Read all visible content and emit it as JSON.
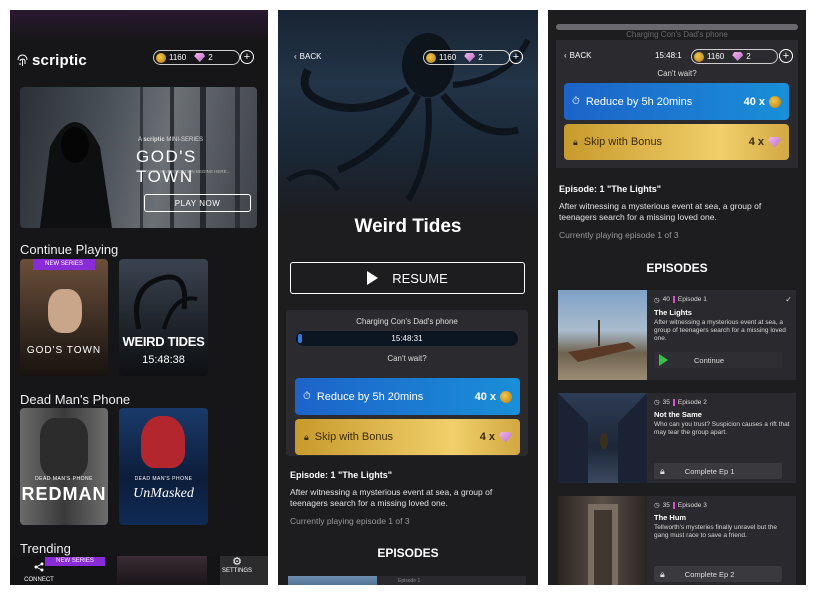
{
  "colors": {
    "accent_pink": "#8a2bd8",
    "reduce_blue": "#1d63c9",
    "skip_gold": "#e0b54a",
    "bg_dark": "#1a1a1c"
  },
  "wallet": {
    "coins": "1160",
    "gems": "2"
  },
  "home": {
    "logo": "scriptic",
    "hero": {
      "tag_prefix": "A",
      "tag_brand": "scriptic",
      "tag_suffix": "MINI-SERIES",
      "title": "GOD'S TOWN",
      "tagline": "YOUR INVESTIGATION BEGINS HERE...",
      "play_label": "PLAY NOW"
    },
    "continue_title": "Continue Playing",
    "continue_items": [
      {
        "badge": "NEW SERIES",
        "title": "GOD'S TOWN"
      },
      {
        "title": "WEIRD TIDES",
        "timer": "15:48:38"
      }
    ],
    "dead_mans_title": "Dead Man's Phone",
    "dead_items": [
      {
        "series": "DEAD MAN'S PHONE",
        "title": "REDMAN"
      },
      {
        "series": "DEAD MAN'S PHONE",
        "title": "UnMasked"
      }
    ],
    "trending_title": "Trending",
    "trending_badge": "NEW SERIES",
    "nav": {
      "connect": "CONNECT",
      "settings": "SETTINGS"
    }
  },
  "detail": {
    "back_label": "BACK",
    "title": "Weird Tides",
    "resume_label": "RESUME",
    "charging": "Charging Con's Dad's phone",
    "timer": "15:48:31",
    "cant_wait": "Can't wait?",
    "reduce_label": "Reduce by 5h 20mins",
    "reduce_cost": "40 x",
    "skip_label": "Skip with Bonus",
    "skip_cost": "4 x",
    "episode_heading": "Episode: 1 \"The Lights\"",
    "episode_desc": "After witnessing a mysterious event at sea, a group of teenagers search for a missing loved one.",
    "progress": "Currently playing episode 1 of 3",
    "episodes_title": "EPISODES",
    "peek_text": "Episode 1"
  },
  "episodes_screen": {
    "charging": "Charging Con's Dad's phone",
    "timer": "15:48:1",
    "episodes": [
      {
        "cost": "40",
        "label": "Episode 1",
        "title": "The Lights",
        "desc": "After witnessing a mysterious event at sea, a group of teenagers search for a missing loved one.",
        "action": "Continue"
      },
      {
        "cost": "35",
        "label": "Episode 2",
        "title": "Not the Same",
        "desc": "Who can you trust? Suspicion causes a rift that may tear the group apart.",
        "action": "Complete Ep 1"
      },
      {
        "cost": "35",
        "label": "Episode 3",
        "title": "The Hum",
        "desc": "Tellworth's mysteries finally unravel but the gang must race to save a friend.",
        "action": "Complete Ep 2"
      }
    ]
  }
}
